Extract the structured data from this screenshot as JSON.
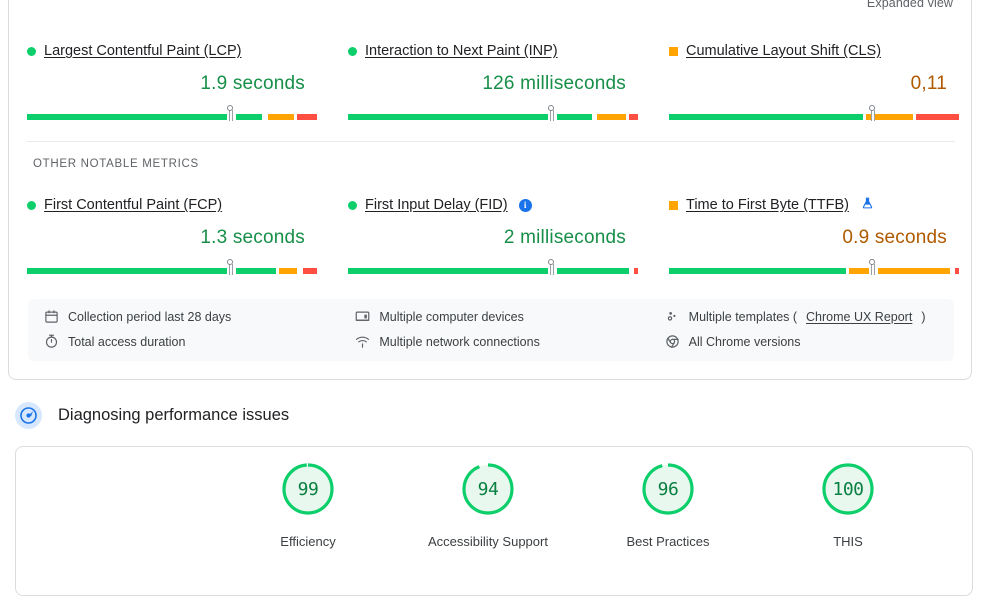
{
  "header": {
    "expanded_view_label": "Expanded view",
    "tab_indicator_color": "#1a73e8"
  },
  "field_data": {
    "section_label": "OTHER NOTABLE METRICS",
    "core_metrics": [
      {
        "name": "Largest Contentful Paint (LCP)",
        "status": "good",
        "status_icon": "green-circle",
        "value": "1.9 seconds",
        "marker_pct": 70,
        "segments": [
          {
            "color": "#0cce6b",
            "start": 0,
            "end": 69
          },
          {
            "color": "#0cce6b",
            "start": 72,
            "end": 81
          },
          {
            "color": "#ffa400",
            "start": 83,
            "end": 92
          },
          {
            "color": "#ff4e42",
            "start": 93,
            "end": 100
          }
        ]
      },
      {
        "name": "Interaction to Next Paint (INP)",
        "status": "good",
        "status_icon": "green-circle",
        "value": "126 milliseconds",
        "marker_pct": 70,
        "segments": [
          {
            "color": "#0cce6b",
            "start": 0,
            "end": 69
          },
          {
            "color": "#0cce6b",
            "start": 72,
            "end": 84
          },
          {
            "color": "#ffa400",
            "start": 86,
            "end": 96
          },
          {
            "color": "#ff4e42",
            "start": 97,
            "end": 100
          }
        ]
      },
      {
        "name": "Cumulative Layout Shift (CLS)",
        "status": "needs-improvement",
        "status_icon": "orange-square",
        "value": "0,11",
        "marker_pct": 70,
        "segments": [
          {
            "color": "#0cce6b",
            "start": 0,
            "end": 67
          },
          {
            "color": "#ffa400",
            "start": 68,
            "end": 72
          },
          {
            "color": "#ffa400",
            "start": 72,
            "end": 84
          },
          {
            "color": "#ff4e42",
            "start": 85,
            "end": 100
          }
        ]
      }
    ],
    "other_metrics": [
      {
        "name": "First Contentful Paint (FCP)",
        "status": "good",
        "status_icon": "green-circle",
        "value": "1.3 seconds",
        "marker_pct": 70,
        "badge": null,
        "segments": [
          {
            "color": "#0cce6b",
            "start": 0,
            "end": 69
          },
          {
            "color": "#0cce6b",
            "start": 72,
            "end": 86
          },
          {
            "color": "#ffa400",
            "start": 87,
            "end": 93
          },
          {
            "color": "#ff4e42",
            "start": 95,
            "end": 100
          }
        ]
      },
      {
        "name": "First Input Delay (FID)",
        "status": "good",
        "status_icon": "green-circle",
        "value": "2 milliseconds",
        "marker_pct": 70,
        "badge": "info-icon",
        "badge_glyph": "i",
        "segments": [
          {
            "color": "#0cce6b",
            "start": 0,
            "end": 69
          },
          {
            "color": "#0cce6b",
            "start": 72,
            "end": 97
          },
          {
            "color": "#ff4e42",
            "start": 98.5,
            "end": 100
          }
        ]
      },
      {
        "name": "Time to First Byte (TTFB)",
        "status": "needs-improvement",
        "status_icon": "orange-square",
        "value": "0.9 seconds",
        "marker_pct": 70,
        "badge": "flask-icon",
        "segments": [
          {
            "color": "#0cce6b",
            "start": 0,
            "end": 61
          },
          {
            "color": "#ffa400",
            "start": 62,
            "end": 69
          },
          {
            "color": "#ffa400",
            "start": 72,
            "end": 97
          },
          {
            "color": "#ff4e42",
            "start": 98.5,
            "end": 100
          }
        ]
      }
    ],
    "meta": {
      "col1": [
        {
          "icon": "calendar-icon",
          "text": "Collection period last 28 days"
        },
        {
          "icon": "stopwatch-icon",
          "text": "Total access duration"
        }
      ],
      "col2": [
        {
          "icon": "desktop-icon",
          "text": "Multiple computer devices"
        },
        {
          "icon": "wifi-icon",
          "text": "Multiple network connections"
        }
      ],
      "col3": [
        {
          "icon": "templates-icon",
          "text_before": "Multiple templates (",
          "link": "Chrome UX Report",
          "text_after": ")"
        },
        {
          "icon": "chrome-icon",
          "text": "All Chrome versions"
        }
      ]
    }
  },
  "diagnostics": {
    "icon": "speedometer-icon",
    "title": "Diagnosing performance issues",
    "scores": [
      {
        "value": "99",
        "label": "Efficiency",
        "pct": 99,
        "color": "#0cce6b"
      },
      {
        "value": "94",
        "label": "Accessibility Support",
        "pct": 94,
        "color": "#0cce6b"
      },
      {
        "value": "96",
        "label": "Best Practices",
        "pct": 96,
        "color": "#0cce6b"
      },
      {
        "value": "100",
        "label": "THIS",
        "pct": 100,
        "color": "#0cce6b"
      }
    ]
  }
}
